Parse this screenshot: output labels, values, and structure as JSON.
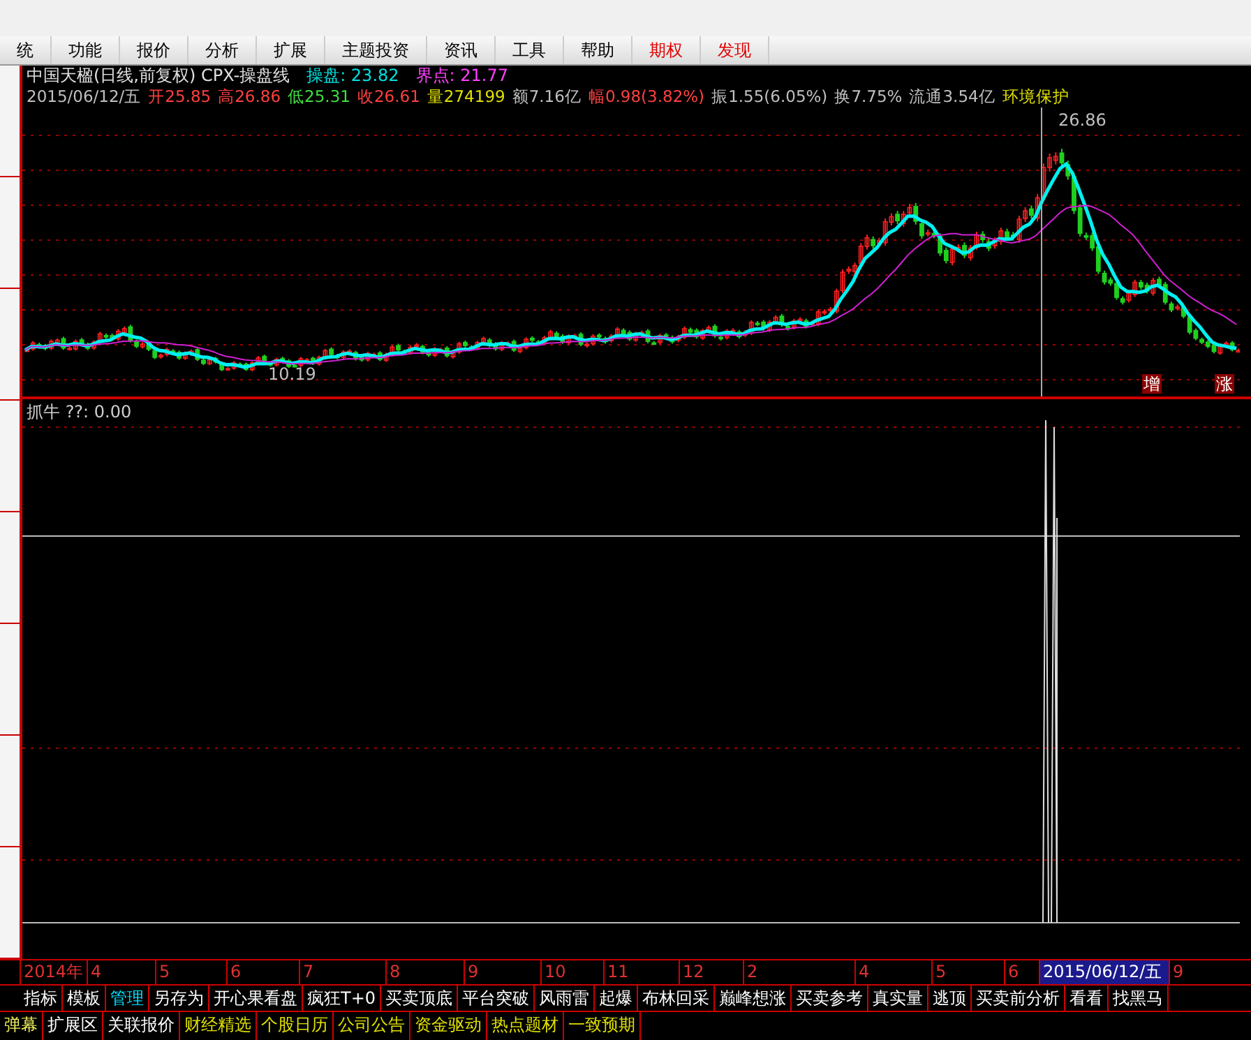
{
  "menu": [
    {
      "label": "统",
      "color": "#000000"
    },
    {
      "label": "功能",
      "color": "#000000"
    },
    {
      "label": "报价",
      "color": "#000000"
    },
    {
      "label": "分析",
      "color": "#000000"
    },
    {
      "label": "扩展",
      "color": "#000000"
    },
    {
      "label": "主题投资",
      "color": "#000000"
    },
    {
      "label": "资讯",
      "color": "#000000"
    },
    {
      "label": "工具",
      "color": "#000000"
    },
    {
      "label": "帮助",
      "color": "#000000"
    },
    {
      "label": "期权",
      "color": "#e00000"
    },
    {
      "label": "发现",
      "color": "#e00000"
    }
  ],
  "header": [
    {
      "text": "中国天楹(日线,前复权) CPX-操盘线",
      "color": "#e0e0e0"
    },
    {
      "text": "操盘: 23.82",
      "color": "#00e0e0"
    },
    {
      "text": "界点: 21.77",
      "color": "#ff40ff"
    }
  ],
  "quote": [
    {
      "text": "2015/06/12/五",
      "color": "#c0c0c0"
    },
    {
      "text": "开25.85",
      "color": "#ff4040"
    },
    {
      "text": "高26.86",
      "color": "#ff4040"
    },
    {
      "text": "低25.31",
      "color": "#40e040"
    },
    {
      "text": "收26.61",
      "color": "#ff4040"
    },
    {
      "text": "量274199",
      "color": "#e0e000"
    },
    {
      "text": "额7.16亿",
      "color": "#c0c0c0"
    },
    {
      "text": "幅0.98(3.82%)",
      "color": "#ff4040"
    },
    {
      "text": "振1.55(6.05%)",
      "color": "#c0c0c0"
    },
    {
      "text": "换7.75%",
      "color": "#c0c0c0"
    },
    {
      "text": "流通3.54亿",
      "color": "#c0c0c0"
    },
    {
      "text": "环境保护",
      "color": "#e0e000"
    }
  ],
  "price_chart": {
    "high_label": "26.86",
    "low_label": "10.19",
    "signals": [
      "增",
      "涨"
    ]
  },
  "indicator": {
    "title": "抓牛 ??: 0.00"
  },
  "date_axis": [
    {
      "label": "2014年",
      "selected": false
    },
    {
      "label": "4",
      "selected": false
    },
    {
      "label": "5",
      "selected": false
    },
    {
      "label": "6",
      "selected": false
    },
    {
      "label": "7",
      "selected": false
    },
    {
      "label": "8",
      "selected": false
    },
    {
      "label": "9",
      "selected": false
    },
    {
      "label": "10",
      "selected": false
    },
    {
      "label": "11",
      "selected": false
    },
    {
      "label": "12",
      "selected": false
    },
    {
      "label": "2",
      "selected": false
    },
    {
      "label": "4",
      "selected": false
    },
    {
      "label": "5",
      "selected": false
    },
    {
      "label": "6",
      "selected": false
    },
    {
      "label": "2015/06/12/五",
      "selected": true
    },
    {
      "label": "9",
      "selected": false
    }
  ],
  "indicator_tabs": [
    {
      "label": "指标",
      "selected": false
    },
    {
      "label": "模板",
      "selected": false
    },
    {
      "label": "管理",
      "selected": true
    },
    {
      "label": "另存为",
      "selected": false
    },
    {
      "label": "开心果看盘",
      "selected": false
    },
    {
      "label": "疯狂T+0",
      "selected": false
    },
    {
      "label": "买卖顶底",
      "selected": false
    },
    {
      "label": "平台突破",
      "selected": false
    },
    {
      "label": "风雨雷",
      "selected": false
    },
    {
      "label": "起爆",
      "selected": false
    },
    {
      "label": "布林回采",
      "selected": false
    },
    {
      "label": "巅峰想涨",
      "selected": false
    },
    {
      "label": "买卖参考",
      "selected": false
    },
    {
      "label": "真实量",
      "selected": false
    },
    {
      "label": "逃顶",
      "selected": false
    },
    {
      "label": "买卖前分析",
      "selected": false
    },
    {
      "label": "看看",
      "selected": false
    },
    {
      "label": "找黑马",
      "selected": false
    }
  ],
  "info_tabs": [
    {
      "label": "弹幕",
      "kind": "live"
    },
    {
      "label": "扩展区",
      "kind": "tool"
    },
    {
      "label": "关联报价",
      "kind": "tool"
    },
    {
      "label": "财经精选",
      "kind": "info"
    },
    {
      "label": "个股日历",
      "kind": "info"
    },
    {
      "label": "公司公告",
      "kind": "info"
    },
    {
      "label": "资金驱动",
      "kind": "info"
    },
    {
      "label": "热点题材",
      "kind": "info"
    },
    {
      "label": "一致预期",
      "kind": "info"
    }
  ]
}
